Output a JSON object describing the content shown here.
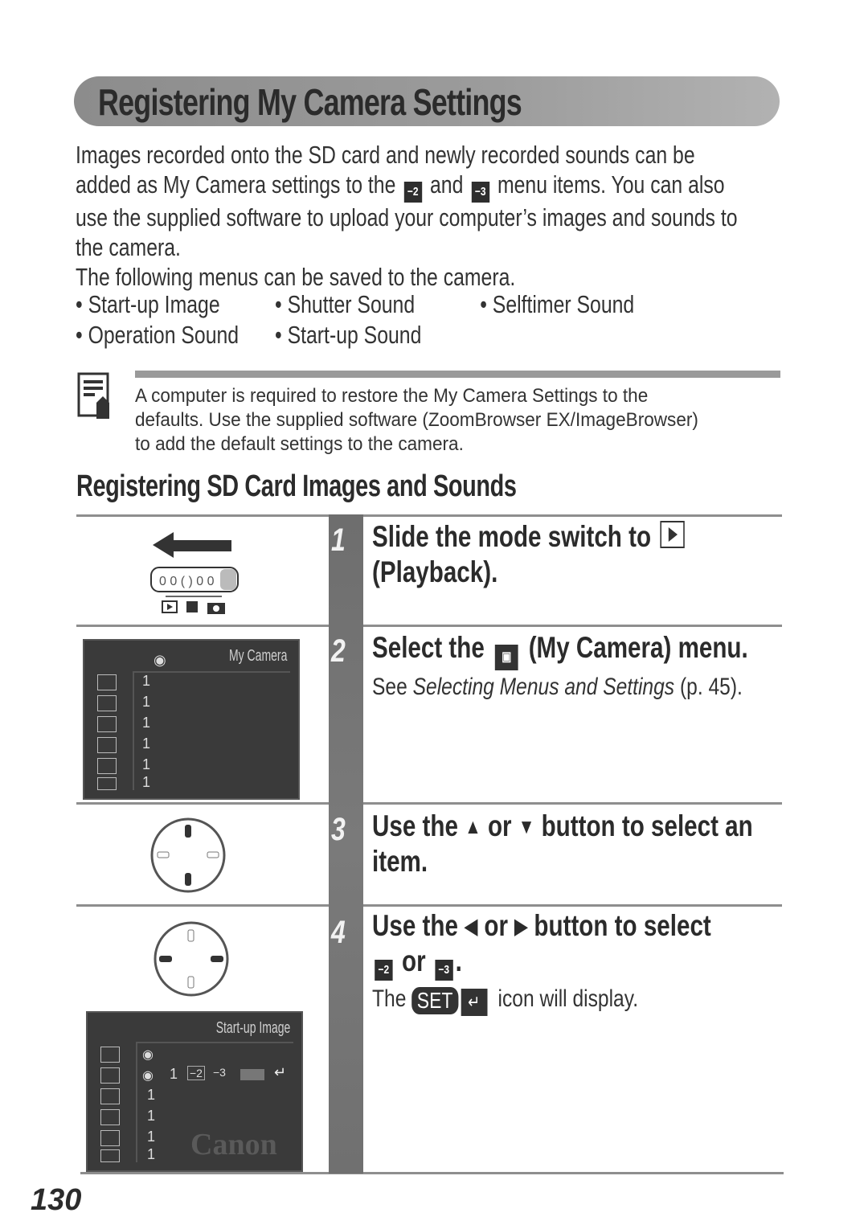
{
  "header": {
    "title": "Registering My Camera Settings"
  },
  "intro": {
    "line1": "Images recorded onto the SD card and newly recorded sounds can be",
    "line2_pre": "added as My Camera settings to the",
    "icon_a": "−2",
    "line2_mid": "and",
    "icon_b": "−3",
    "line2_post": "menu items. You can also",
    "line3": "use the supplied software to upload your computer’s images and sounds to",
    "line4": "the camera.",
    "line5": "The following menus can be saved to the camera."
  },
  "menus": [
    "• Start-up Image",
    "• Shutter Sound",
    "• Selftimer Sound",
    "• Operation Sound",
    "• Start-up Sound"
  ],
  "note": {
    "icon": "note-pencil-icon",
    "line1": "A computer is required to restore the My Camera Settings to the",
    "line2": "defaults. Use the supplied software (ZoomBrowser EX/ImageBrowser)",
    "line3": "to add the default settings to the camera."
  },
  "section": {
    "heading": "Registering SD Card Images and Sounds"
  },
  "steps": [
    {
      "num": "1",
      "title_pre": "Slide the mode switch to",
      "title_post": "(Playback)."
    },
    {
      "num": "2",
      "title_pre": "Select the",
      "icon": "▣",
      "title_post": "(My Camera) menu.",
      "sub_pre": "See",
      "sub_italic": "Selecting Menus and Settings",
      "sub_post": "(p. 45)."
    },
    {
      "num": "3",
      "title_pre": "Use the",
      "up": "▲",
      "or": "or",
      "down": "▼",
      "title_post": "button to select an item."
    },
    {
      "num": "4",
      "title_pre": "Use the",
      "left": "◀",
      "or": "or",
      "right": "▶",
      "title_post": "button to select",
      "icon_a": "−2",
      "or2": "or",
      "icon_b": "−3",
      "period": ".",
      "sub_pre": "The",
      "set": "SET",
      "ret": "↵",
      "sub_post": "icon will display."
    }
  ],
  "lcd1": {
    "header": "My Camera",
    "values": [
      "1",
      "1",
      "1",
      "1",
      "1",
      "1"
    ]
  },
  "lcd2": {
    "header": "Start-up Image",
    "row2": [
      "1",
      "−2",
      "−3"
    ],
    "values": [
      "1",
      "1",
      "1",
      "1"
    ],
    "brand": "Canon"
  },
  "mode_switch": {
    "labels": [
      "▶",
      "•••",
      "■"
    ]
  },
  "footer": {
    "page_number": "130"
  }
}
